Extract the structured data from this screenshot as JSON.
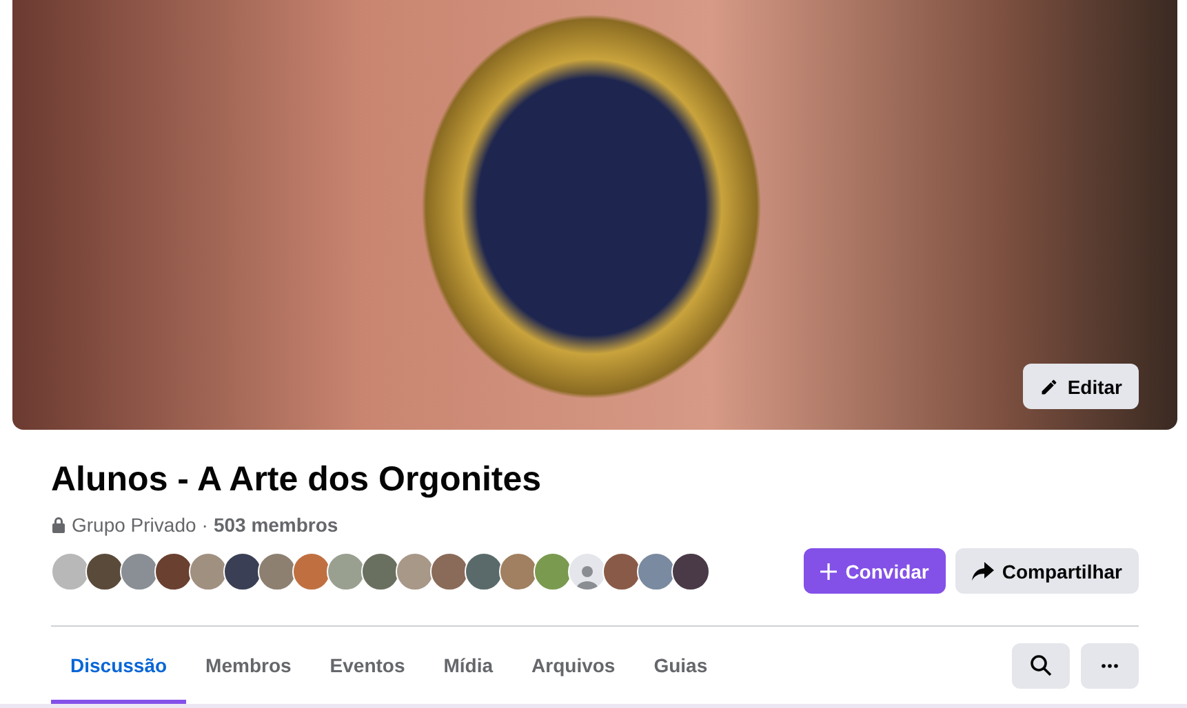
{
  "cover": {
    "edit_button": "Editar"
  },
  "group": {
    "name": "Alunos - A Arte dos Orgonites",
    "privacy": "Grupo Privado",
    "separator": "·",
    "members": "503 membros"
  },
  "member_avatars": [
    {
      "kind": "photo"
    },
    {
      "kind": "photo"
    },
    {
      "kind": "photo"
    },
    {
      "kind": "photo"
    },
    {
      "kind": "photo"
    },
    {
      "kind": "photo"
    },
    {
      "kind": "photo"
    },
    {
      "kind": "photo"
    },
    {
      "kind": "photo"
    },
    {
      "kind": "photo"
    },
    {
      "kind": "photo"
    },
    {
      "kind": "photo"
    },
    {
      "kind": "photo"
    },
    {
      "kind": "photo"
    },
    {
      "kind": "photo"
    },
    {
      "kind": "silhouette"
    },
    {
      "kind": "photo"
    },
    {
      "kind": "photo"
    },
    {
      "kind": "photo"
    }
  ],
  "actions": [
    {
      "kind": "primary",
      "label": "Convidar"
    },
    {
      "kind": "secondary",
      "label": "Compartilhar"
    }
  ],
  "tabs": [
    {
      "label": "Discussão",
      "selected": true
    },
    {
      "label": "Membros",
      "selected": false
    },
    {
      "label": "Eventos",
      "selected": false
    },
    {
      "label": "Mídia",
      "selected": false
    },
    {
      "label": "Arquivos",
      "selected": false
    },
    {
      "label": "Guias",
      "selected": false
    }
  ]
}
